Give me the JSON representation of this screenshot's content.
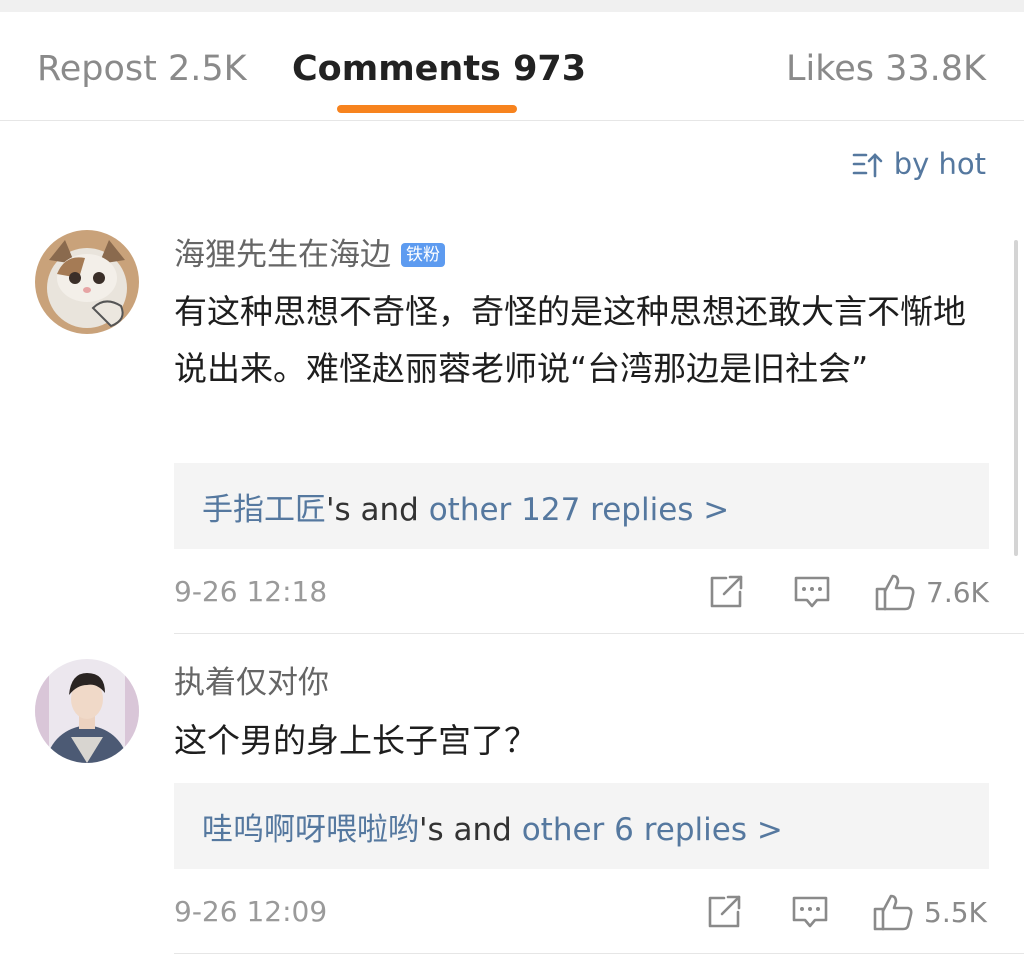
{
  "tabs": {
    "repost": "Repost 2.5K",
    "comments": "Comments 973",
    "likes": "Likes 33.8K"
  },
  "sort": {
    "label": "by hot",
    "icon": "sort-icon"
  },
  "comments": [
    {
      "username": "海狸先生在海边",
      "badge": "铁粉",
      "text": "有这种思想不奇怪，奇怪的是这种思想还敢大言不惭地说出来。难怪赵丽蓉老师说“台湾那边是旧社会”",
      "replies": {
        "user": "手指工匠",
        "mid": "'s and ",
        "link": "other 127 replies >"
      },
      "time": "9-26 12:18",
      "likes": "7.6K"
    },
    {
      "username": "执着仅对你",
      "text": "这个男的身上长子宫了？",
      "replies": {
        "user": "哇呜啊呀喂啦哟",
        "mid": "'s and ",
        "link": "other 6 replies >"
      },
      "time": "9-26 12:09",
      "likes": "5.5K"
    }
  ],
  "colors": {
    "accent": "#f7831e",
    "link": "#55789f",
    "badge": "#5d9bf0"
  }
}
